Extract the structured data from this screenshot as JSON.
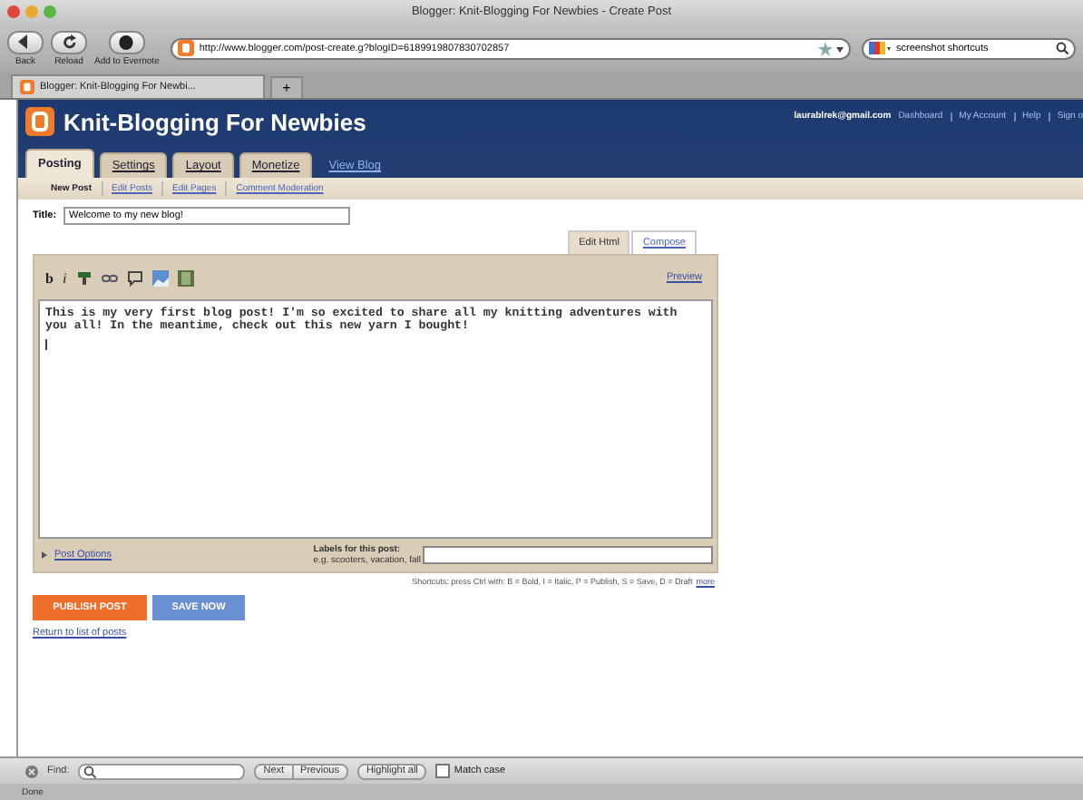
{
  "window": {
    "title": "Blogger: Knit-Blogging For Newbies - Create Post"
  },
  "toolbar": {
    "buttons": [
      "Back",
      "Reload",
      "Add to Evernote"
    ],
    "url": "http://www.blogger.com/post-create.g?blogID=6189919807830702857",
    "search": "screenshot shortcuts"
  },
  "browser_tabs": [
    {
      "label": "Blogger: Knit-Blogging For Newbi...",
      "selected": true
    }
  ],
  "new_tab": "+",
  "blog": {
    "title": "Knit-Blogging For Newbies",
    "email": "laurablrek@gmail.com",
    "links": [
      "Dashboard",
      "My Account",
      "Help",
      "Sign o"
    ]
  },
  "tabs": [
    {
      "label": "Posting",
      "selected": true,
      "kind": "tab"
    },
    {
      "label": "Settings",
      "selected": false,
      "kind": "tab"
    },
    {
      "label": "Layout",
      "selected": false,
      "kind": "tab"
    },
    {
      "label": "Monetize",
      "selected": false,
      "kind": "tab"
    },
    {
      "label": "View Blog",
      "selected": false,
      "kind": "link"
    }
  ],
  "subtabs": [
    {
      "label": "New Post",
      "selected": true
    },
    {
      "label": "Edit Posts",
      "selected": false
    },
    {
      "label": "Edit Pages",
      "selected": false
    },
    {
      "label": "Comment Moderation",
      "selected": false
    }
  ],
  "post": {
    "title_label": "Title:",
    "title": "Welcome to my new blog!"
  },
  "editor_modes": [
    {
      "label": "Edit Html",
      "selected": true
    },
    {
      "label": "Compose",
      "selected": false
    }
  ],
  "format_text_buttons": [
    "b",
    "i"
  ],
  "preview": "Preview",
  "body": "This is my very first blog post! I'm so excited to share all my knitting adventures with you all! In the meantime, check out this new yarn I bought!",
  "post_options": "Post Options",
  "labels": {
    "label": "Labels for this post:",
    "hint": "e.g. scooters, vacation, fall"
  },
  "shortcuts": {
    "text": "Shortcuts: press Ctrl with: B = Bold, I = Italic, P = Publish, S = Save, D = Draft",
    "link": "more"
  },
  "actions": {
    "publish": "PUBLISH POST",
    "save": "SAVE NOW",
    "return": "Return to list of posts"
  },
  "find_bar": {
    "label": "Find:",
    "next": "Next",
    "previous": "Previous",
    "highlight": "Highlight all",
    "match_case": "Match case",
    "match_case_checked": false
  },
  "status": "Done"
}
